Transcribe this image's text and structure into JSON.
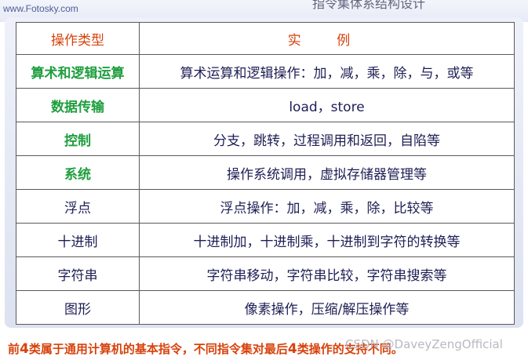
{
  "header": {
    "site": "www.Fotosky.com",
    "title": "指令集体系结构设计"
  },
  "table": {
    "headers": [
      "操作类型",
      "实 例"
    ],
    "rows": [
      {
        "type": "算术和逻辑运算",
        "example": "算术运算和逻辑操作：加，减，乘，除，与，或等",
        "highlight": true
      },
      {
        "type": "数据传输",
        "example": "load，store",
        "highlight": true
      },
      {
        "type": "控制",
        "example": "分支，跳转，过程调用和返回，自陷等",
        "highlight": true
      },
      {
        "type": "系统",
        "example": "操作系统调用，虚拟存储器管理等",
        "highlight": true
      },
      {
        "type": "浮点",
        "example": "浮点操作：加，减，乘，除，比较等",
        "highlight": false
      },
      {
        "type": "十进制",
        "example": "十进制加，十进制乘，十进制到字符的转换等",
        "highlight": false
      },
      {
        "type": "字符串",
        "example": "字符串移动，字符串比较，字符串搜索等",
        "highlight": false
      },
      {
        "type": "图形",
        "example": "像素操作，压缩/解压操作等",
        "highlight": false
      }
    ]
  },
  "footnote": {
    "part1": "前",
    "num1": "4",
    "part2": "类属于通用计算机的基本指令，不同指令集对最后",
    "num2": "4",
    "part3": "类操作的支持不同。"
  },
  "watermark": "CSDN @DaveyZengOfficial",
  "colors": {
    "header_text": "#d7420c",
    "highlight_text": "#1e9e3e",
    "body_text": "#1e1e55"
  }
}
